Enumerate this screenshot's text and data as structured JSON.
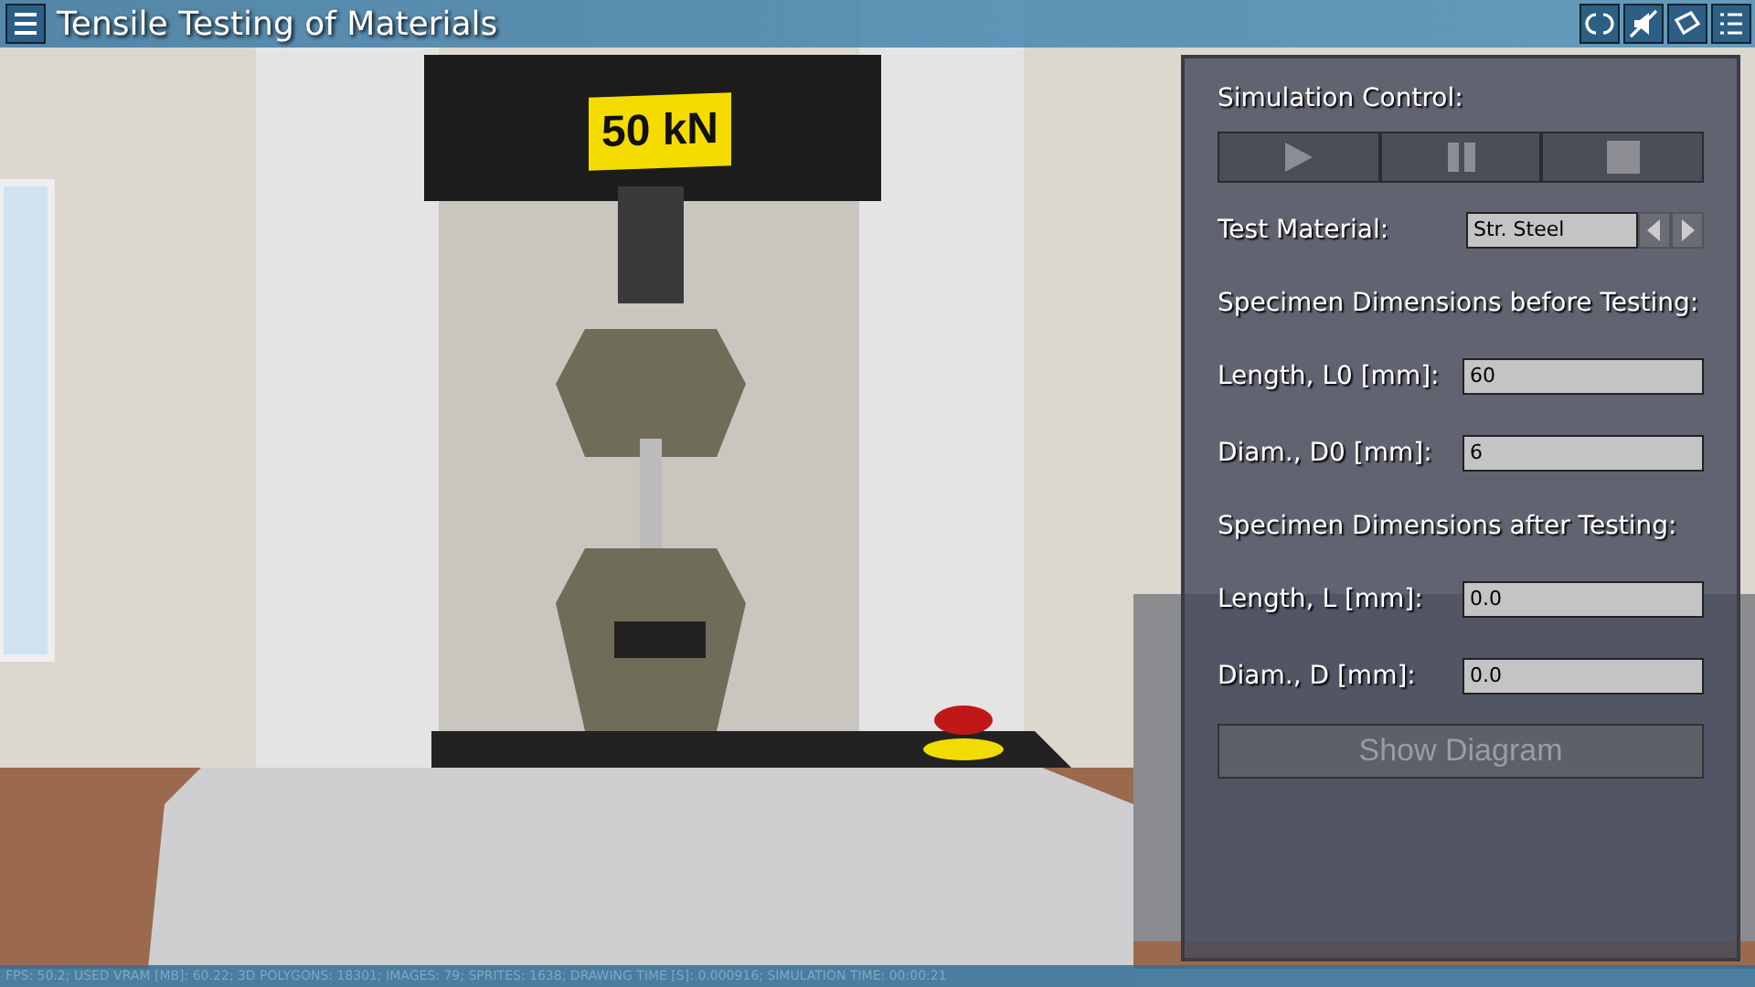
{
  "window": {
    "title": "Tensile Testing of Materials"
  },
  "toolbar": [
    {
      "kind": "reset"
    },
    {
      "kind": "mute"
    },
    {
      "kind": "notes"
    },
    {
      "kind": "list"
    }
  ],
  "scene": {
    "machine_label": "50 kN"
  },
  "panel": {
    "simulation_control": {
      "label": "Simulation Control:",
      "buttons": [
        {
          "kind": "play"
        },
        {
          "kind": "pause"
        },
        {
          "kind": "stop"
        }
      ]
    },
    "material": {
      "label": "Test Material:",
      "value": "Str. Steel"
    },
    "before": {
      "heading": "Specimen Dimensions before Testing:",
      "fields": [
        {
          "label": "Length, L0 [mm]:",
          "value": "60"
        },
        {
          "label": "Diam., D0 [mm]:",
          "value": "6"
        }
      ]
    },
    "after": {
      "heading": "Specimen Dimensions after Testing:",
      "fields": [
        {
          "label": "Length, L [mm]:",
          "value": "0.0"
        },
        {
          "label": "Diam., D [mm]:",
          "value": "0.0"
        }
      ]
    },
    "show_diagram": {
      "label": "Show Diagram",
      "disabled": true
    }
  },
  "status_bar": "FPS: 50.2; USED VRAM [MB]: 60.22; 3D POLYGONS: 18301; IMAGES: 79; SPRITES: 1638; DRAWING TIME [S]: 0.000916; SIMULATION TIME: 00:00:21"
}
